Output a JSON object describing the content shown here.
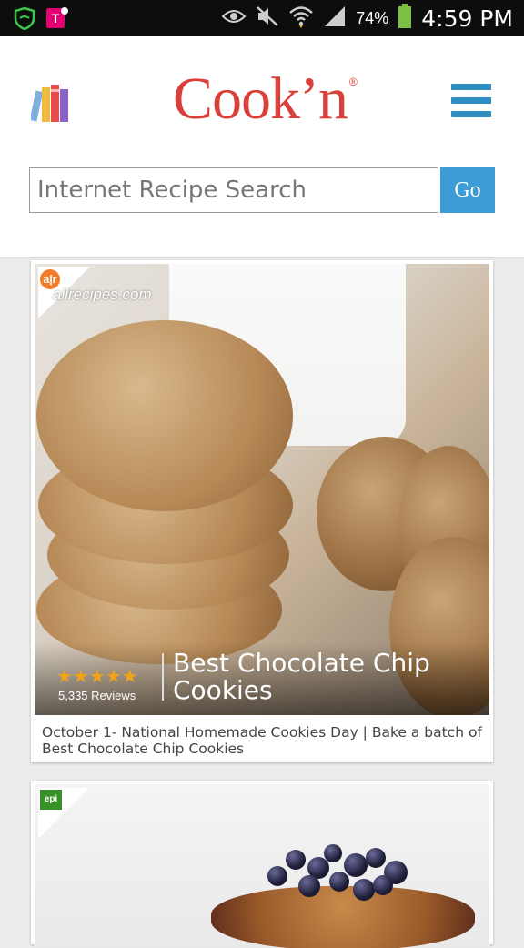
{
  "status_bar": {
    "battery_percent": "74%",
    "time": "4:59 PM",
    "icons": [
      "shield-icon",
      "tmobile-icon",
      "eye-icon",
      "mute-icon",
      "wifi-icon",
      "signal-icon",
      "battery-icon"
    ]
  },
  "header": {
    "logo_text": "Cook’n",
    "logo_mark": "®",
    "brand_color": "#d9403a",
    "accent_color": "#2f8fc2"
  },
  "search": {
    "placeholder": "Internet Recipe Search",
    "go_label": "Go"
  },
  "cards": [
    {
      "source": "allrecipes.com",
      "source_badge": "a|r",
      "rating": 4.5,
      "stars": "★★★★★",
      "reviews": "5,335 Reviews",
      "title": "Best Chocolate Chip Cookies",
      "caption": "October 1- National Homemade Cookies Day | Bake a batch of Best Chocolate Chip Cookies"
    },
    {
      "source_badge": "epi"
    }
  ]
}
